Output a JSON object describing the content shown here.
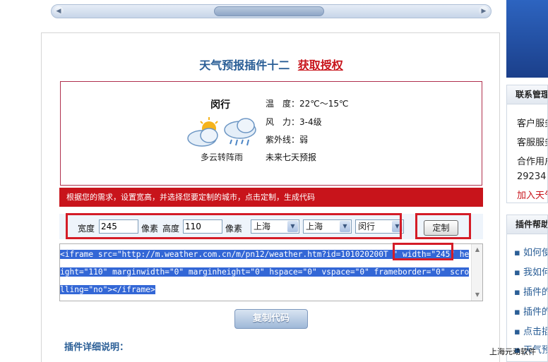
{
  "title": {
    "main": "天气预报插件十二",
    "link": "获取授权"
  },
  "preview": {
    "city": "闵行",
    "condition": "多云转阵雨",
    "temp_label": "温　度：",
    "temp_value": "22℃～15℃",
    "wind_label": "风　力：",
    "wind_value": "3-4级",
    "uv_label": "紫外线：",
    "uv_value": "弱",
    "forecast_link": "未来七天预报"
  },
  "instruction": "根据您的需求，设置宽高，并选择您要定制的城市，点击定制，生成代码",
  "controls": {
    "width_label": "宽度",
    "width_value": "245",
    "width_unit": "像素",
    "height_label": "高度",
    "height_value": "110",
    "height_unit": "像素",
    "province": "上海",
    "city": "上海",
    "district": "闵行",
    "custom_button": "定制"
  },
  "code": {
    "part1": "<iframe src=\"http://m.weather.com.cn/m/pn12/weather.htm?id=",
    "city_id": "101020200T",
    "part2": " \" width=\"245\" height=\"110\" marginwidth=\"0\" marginheight=\"0\" hspace=\"0\" vspace=\"0\" frameborder=\"0\" scrolling=\"no\"></iframe>"
  },
  "copy_button": "复制代码",
  "detail_heading": "插件详细说明：",
  "sidebar": {
    "contact_heading": "联系管理",
    "contact_lines": [
      "客户服务",
      "客服服务",
      "合作用户",
      "29234"
    ],
    "join_link": "加入天气",
    "help_heading": "插件帮助",
    "help_items": [
      "如何使",
      "我如何",
      "插件的",
      "插件的",
      "点击插",
      "天气预"
    ]
  },
  "footer": "上海元动软件"
}
